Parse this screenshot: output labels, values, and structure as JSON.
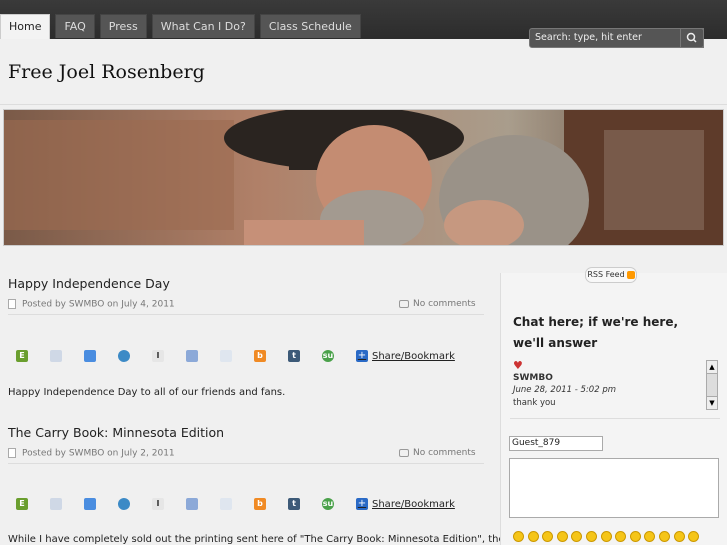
{
  "nav": {
    "tabs": [
      "Home",
      "FAQ",
      "Press",
      "What Can I Do?",
      "Class Schedule"
    ],
    "active": "Home"
  },
  "search": {
    "placeholder": "Search: type, hit enter"
  },
  "site": {
    "title": "Free Joel Rosenberg"
  },
  "posts": [
    {
      "title": "Happy Independence Day",
      "meta": "Posted by SWMBO on July 4, 2011",
      "comments": "No comments",
      "share_label": "Share/Bookmark",
      "body": "Happy Independence Day to all of our friends and fans."
    },
    {
      "title": "The Carry Book: Minnesota Edition",
      "meta": "Posted by SWMBO on July 2, 2011",
      "comments": "No comments",
      "share_label": "Share/Bookmark",
      "body": "While I have completely sold out the printing sent here of \"The Carry Book: Minnesota Edition\", the book is"
    }
  ],
  "sidebar": {
    "rss_label": "RSS Feed",
    "chat_title": "Chat here; if we're here, we'll answer",
    "chat_message": {
      "user": "SWMBO",
      "date": "June 28, 2011 - 5:02 pm",
      "text": "thank you"
    },
    "guest_name": "Guest_879"
  },
  "share_icons": [
    "evernote-icon",
    "delicious-icon",
    "google-icon",
    "chat-icon",
    "instapaper-icon",
    "bookmark-icon",
    "reddit-icon",
    "blogger-icon",
    "tumblr-icon",
    "stumbleupon-icon"
  ],
  "colors": {
    "topbar": "#333333",
    "active_tab": "#f3f3f3",
    "page_bg": "#f0f0f0"
  }
}
